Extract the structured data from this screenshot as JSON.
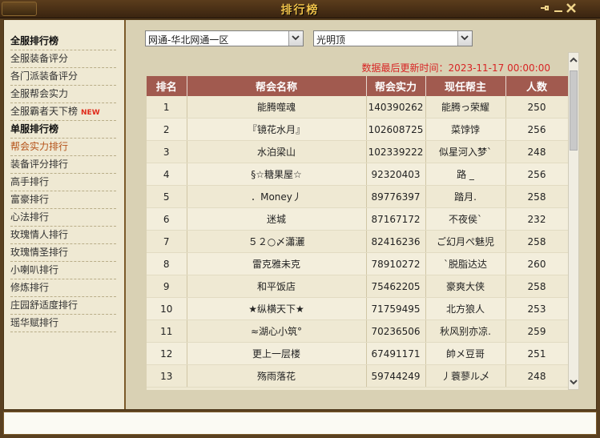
{
  "window": {
    "title": "排行榜"
  },
  "sidebar": {
    "items": [
      {
        "label": "全服排行榜",
        "type": "head"
      },
      {
        "label": "全服装备评分",
        "type": "item"
      },
      {
        "label": "各门派装备评分",
        "type": "item"
      },
      {
        "label": "全服帮会实力",
        "type": "item"
      },
      {
        "label": "全服霸者天下榜",
        "type": "item",
        "badge": "NEW"
      },
      {
        "label": "单服排行榜",
        "type": "head"
      },
      {
        "label": "帮会实力排行",
        "type": "active"
      },
      {
        "label": "装备评分排行",
        "type": "item"
      },
      {
        "label": "高手排行",
        "type": "item"
      },
      {
        "label": "富豪排行",
        "type": "item"
      },
      {
        "label": "心法排行",
        "type": "item"
      },
      {
        "label": "玫瑰情人排行",
        "type": "item"
      },
      {
        "label": "玫瑰情圣排行",
        "type": "item"
      },
      {
        "label": "小喇叭排行",
        "type": "item"
      },
      {
        "label": "修炼排行",
        "type": "item"
      },
      {
        "label": "庄园舒适度排行",
        "type": "item"
      },
      {
        "label": "瑶华赋排行",
        "type": "item"
      }
    ]
  },
  "filters": {
    "server": "网通-华北网通一区",
    "zone": "光明顶"
  },
  "updated": "数据最后更新时间：2023-11-17 00:00:00",
  "table": {
    "columns": [
      "排名",
      "帮会名称",
      "帮会实力",
      "现任帮主",
      "人数"
    ],
    "rows": [
      [
        "1",
        "能腾噬魂",
        "140390262",
        "能腾っ荣耀",
        "250"
      ],
      [
        "2",
        "『镜花水月』",
        "102608725",
        "菜饽饽",
        "256"
      ],
      [
        "3",
        "水泊梁山",
        "102339222",
        "似星河入梦`",
        "248"
      ],
      [
        "4",
        "§☆糖果屋☆",
        "92320403",
        "路 _",
        "256"
      ],
      [
        "5",
        "．Money丿",
        "89776397",
        "踏月.",
        "258"
      ],
      [
        "6",
        "迷城",
        "87167172",
        "不夜侯`",
        "232"
      ],
      [
        "7",
        "５２○〆瀟灑",
        "82416236",
        "ご幻月ぺ魅児",
        "258"
      ],
      [
        "8",
        "雷克雅未克",
        "78910272",
        "`脱脂达达",
        "260"
      ],
      [
        "9",
        "和平饭店",
        "75462205",
        "豪爽大侠",
        "258"
      ],
      [
        "10",
        "★纵横天下★",
        "71759495",
        "北方狼人",
        "253"
      ],
      [
        "11",
        "≈湖心小筑°",
        "70236506",
        "秋风别亦凉.",
        "259"
      ],
      [
        "12",
        "更上一层楼",
        "67491171",
        "帥メ豆哥",
        "251"
      ],
      [
        "13",
        "殇雨落花",
        "59744249",
        "丿蓑蓼ル乄",
        "248"
      ]
    ]
  },
  "icons": {
    "pin": "pin-icon",
    "minimize": "minimize-icon",
    "close": "close-icon",
    "scroll_up": "chevron-up-icon",
    "scroll_down": "chevron-down-icon",
    "dropdown": "chevron-down-icon"
  },
  "colors": {
    "title": "#f2c34a",
    "header_bg": "#a15a4f",
    "active_item": "#b5531a",
    "new_badge": "#e02a1a",
    "updated_text": "#d82424"
  }
}
